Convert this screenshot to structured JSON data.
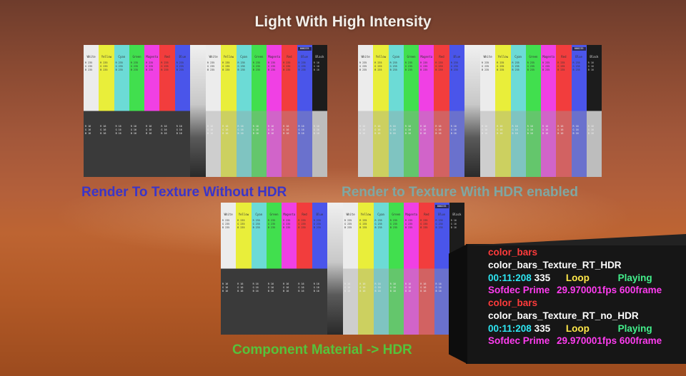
{
  "title": "Light With High Intensity",
  "captions": {
    "left": "Render To Texture Without HDR",
    "right": "Render to Texture With HDR enabled",
    "bottom": "Component Material -> HDR"
  },
  "bar_labels": [
    "White",
    "Yellow",
    "Cyan",
    "Green",
    "Magenta",
    "Red",
    "Blue"
  ],
  "black_label": "Black",
  "tag_label": "000235",
  "info": {
    "block1": {
      "name": "color_bars",
      "texture": "color_bars_Texture_RT_HDR",
      "time": "00:11:208",
      "frame": "335",
      "loop": "Loop",
      "state": "Playing",
      "decoder": "Sofdec Prime",
      "fps": "29.970001fps",
      "frames": "600frame"
    },
    "block2": {
      "name": "color_bars",
      "texture": "color_bars_Texture_RT_no_HDR",
      "time": "00:11:208",
      "frame": "335",
      "loop": "Loop",
      "state": "Playing",
      "decoder": "Sofdec Prime",
      "fps": "29.970001fps",
      "frames": "600frame"
    }
  },
  "colors": {
    "caption_left": "#3b35c8",
    "caption_right": "#7fa7a2",
    "caption_bottom": "#56c23c",
    "info_red": "#ff3b3b",
    "info_white": "#ffffff",
    "info_cyan": "#2ee6f2",
    "info_yellow": "#ffe84a",
    "info_green": "#43f08c",
    "info_magenta": "#ff3cf0",
    "bar_white": "#ececec",
    "bar_yellow": "#e9ee3a",
    "bar_cyan": "#6cdbd6",
    "bar_green": "#41df4e",
    "bar_magenta": "#f040e4",
    "bar_red": "#f23d3d",
    "bar_blue": "#4a55ea"
  }
}
